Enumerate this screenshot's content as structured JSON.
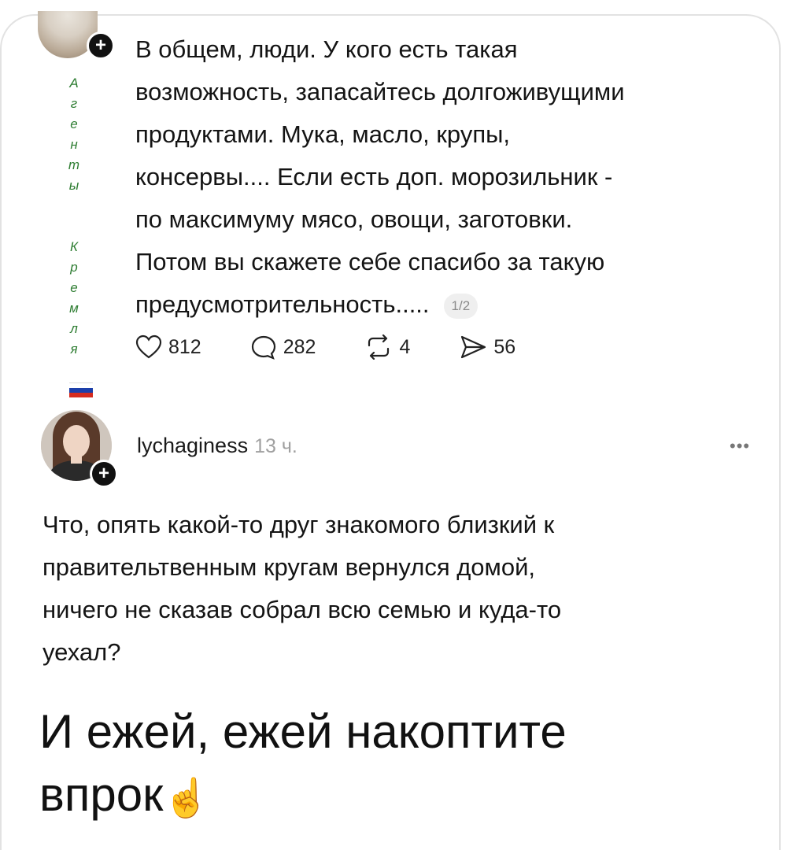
{
  "post1": {
    "author_side_letters": [
      "А",
      "г",
      "е",
      "н",
      "т",
      "ы",
      "",
      "К",
      "р",
      "е",
      "м",
      "л",
      "я"
    ],
    "author_side_colors": [
      "#2e7d32",
      "#2e7d32",
      "#2e7d32",
      "#2e7d32",
      "#2e7d32",
      "#2e7d32",
      "#2e7d32",
      "#2e7d32",
      "#2e7d32",
      "#2e7d32",
      "#2e7d32",
      "#2e7d32",
      "#2e7d32"
    ],
    "lines": [
      "В общем, люди. У кого есть такая",
      "возможность, запасайтесь долгоживущими",
      "продуктами. Мука, масло, крупы,",
      "консервы.... Если есть доп. морозильник -",
      "по максимуму мясо, овощи, заготовки.",
      "Потом вы скажете себе спасибо за такую",
      "предусмотрительность....."
    ],
    "page_indicator": "1/2",
    "likes": "812",
    "comments": "282",
    "reposts": "4",
    "shares": "56"
  },
  "post2": {
    "username": "lychaginess",
    "time": "13 ч.",
    "more": "•••",
    "lines": [
      "Что, опять какой-то друг знакомого близкий к",
      "правительтвенным кругам вернулся домой,",
      "ничего не сказав собрал всю семью и куда-то",
      "уехал?"
    ]
  },
  "caption": {
    "line1": "И ежей, ежей накоптите",
    "line2": "впрок",
    "emoji": "☝️"
  },
  "colors": {
    "side_text": "#2e7d32",
    "flag_white": "#ffffff",
    "flag_blue": "#1c3faa",
    "flag_red": "#d52b1e"
  }
}
